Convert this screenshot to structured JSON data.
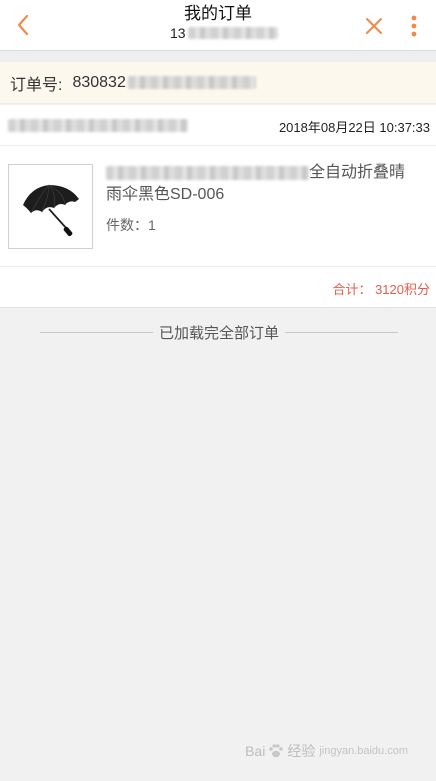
{
  "header": {
    "title": "我的订单",
    "subtitle_prefix": "13",
    "back_icon": "chevron-left-icon",
    "close_icon": "close-icon",
    "more_icon": "more-vertical-icon",
    "accent_color": "#f08a4b"
  },
  "order": {
    "number_label": "订单号:",
    "number_prefix": "830832",
    "date": "2018年08月22日 10:37:33"
  },
  "product": {
    "image_icon": "umbrella-icon",
    "name_suffix_line1": "全自动折叠晴",
    "name_line2": "雨伞黑色SD-006",
    "quantity": "件数：1"
  },
  "total": {
    "text": "合计：  3120积分",
    "color": "#e45c4d"
  },
  "list_end_text": "已加载完全部订单",
  "watermark": {
    "brand": "Bai",
    "brand2": "经验",
    "sub": "jingyan.baidu.com"
  }
}
